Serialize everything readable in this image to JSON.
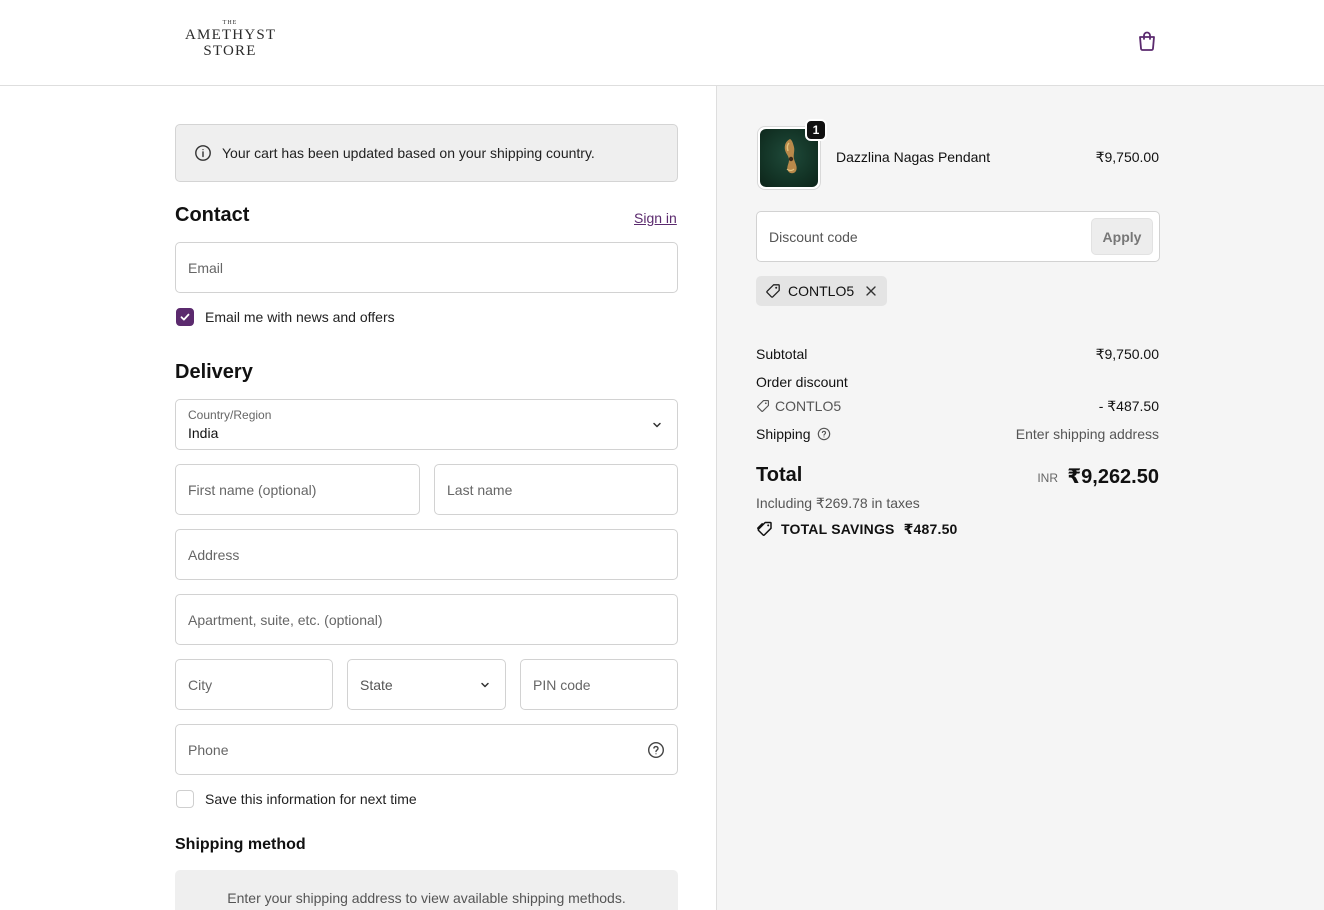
{
  "header": {
    "logo_the": "THE",
    "logo_line1": "AMETHYST",
    "logo_line2": "STORE"
  },
  "notice": {
    "text": "Your cart has been updated based on your shipping country."
  },
  "contact": {
    "title": "Contact",
    "sign_in": "Sign in",
    "email_placeholder": "Email",
    "newsletter_label": "Email me with news and offers",
    "newsletter_checked": true
  },
  "delivery": {
    "title": "Delivery",
    "country_label": "Country/Region",
    "country_value": "India",
    "first_name_placeholder": "First name (optional)",
    "last_name_placeholder": "Last name",
    "address_placeholder": "Address",
    "apartment_placeholder": "Apartment, suite, etc. (optional)",
    "city_placeholder": "City",
    "state_value": "State",
    "pin_placeholder": "PIN code",
    "phone_placeholder": "Phone",
    "save_info_label": "Save this information for next time",
    "save_info_checked": false
  },
  "shipping_method": {
    "title": "Shipping method",
    "message": "Enter your shipping address to view available shipping methods."
  },
  "summary": {
    "product": {
      "quantity": "1",
      "name": "Dazzlina Nagas Pendant",
      "price": "₹9,750.00"
    },
    "discount_placeholder": "Discount code",
    "apply_label": "Apply",
    "applied_code": "CONTLO5",
    "subtotal_label": "Subtotal",
    "subtotal_value": "₹9,750.00",
    "order_discount_label": "Order discount",
    "order_discount_code": "CONTLO5",
    "order_discount_value": "- ₹487.50",
    "shipping_label": "Shipping",
    "shipping_value": "Enter shipping address",
    "total_label": "Total",
    "total_currency": "INR",
    "total_value": "₹9,262.50",
    "taxes_text": "Including ₹269.78 in taxes",
    "savings_label": "TOTAL SAVINGS",
    "savings_value": "₹487.50"
  },
  "colors": {
    "accent": "#5b2a6e",
    "summary_bg": "#f5f5f5",
    "border": "#d2d2d2"
  },
  "icons": [
    "shopping-bag-icon",
    "info-icon",
    "chevron-down-icon",
    "help-circle-icon",
    "check-icon",
    "tag-icon",
    "close-icon",
    "tags-icon"
  ]
}
